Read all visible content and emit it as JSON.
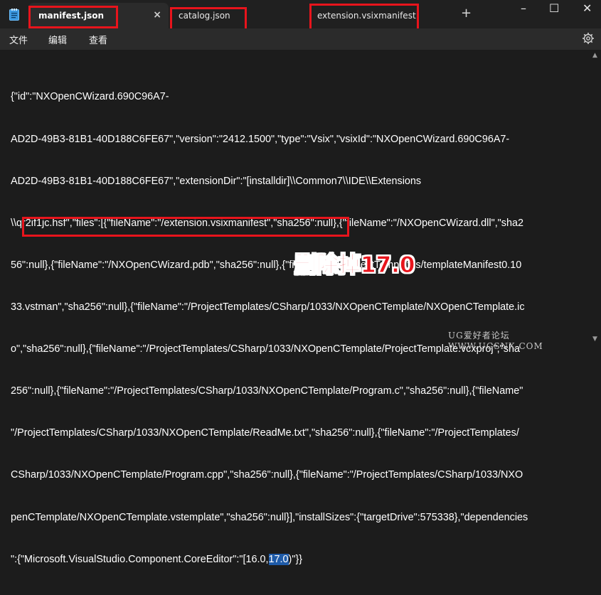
{
  "tabs": [
    {
      "label": "manifest.json",
      "active": true,
      "close_icon": "×"
    },
    {
      "label": "catalog.json",
      "active": false
    },
    {
      "label": "extension.vsixmanifest",
      "active": false
    }
  ],
  "tab_add": "+",
  "window_controls": {
    "minimize": "–",
    "maximize": "☐",
    "close": "✕"
  },
  "menu": {
    "file": "文件",
    "edit": "编辑",
    "view": "查看"
  },
  "editor": {
    "lines": [
      "{\"id\":\"NXOpenCWizard.690C96A7-",
      "AD2D-49B3-81B1-40D188C6FE67\",\"version\":\"2412.1500\",\"type\":\"Vsix\",\"vsixId\":\"NXOpenCWizard.690C96A7-",
      "AD2D-49B3-81B1-40D188C6FE67\",\"extensionDir\":\"[installdir]\\\\Common7\\\\IDE\\\\Extensions",
      "\\\\qr2if1jc.hsf\",\"files\":[{\"fileName\":\"/extension.vsixmanifest\",\"sha256\":null},{\"fileName\":\"/NXOpenCWizard.dll\",\"sha2",
      "56\":null},{\"fileName\":\"/NXOpenCWizard.pdb\",\"sha256\":null},{\"fileName\":\"/ProjectTemplates/templateManifest0.10",
      "33.vstman\",\"sha256\":null},{\"fileName\":\"/ProjectTemplates/CSharp/1033/NXOpenCTemplate/NXOpenCTemplate.ic",
      "o\",\"sha256\":null},{\"fileName\":\"/ProjectTemplates/CSharp/1033/NXOpenCTemplate/ProjectTemplate.vcxproj\",\"sha",
      "256\":null},{\"fileName\":\"/ProjectTemplates/CSharp/1033/NXOpenCTemplate/Program.c\",\"sha256\":null},{\"fileName\"",
      "\"/ProjectTemplates/CSharp/1033/NXOpenCTemplate/ReadMe.txt\",\"sha256\":null},{\"fileName\":\"/ProjectTemplates/",
      "CSharp/1033/NXOpenCTemplate/Program.cpp\",\"sha256\":null},{\"fileName\":\"/ProjectTemplates/CSharp/1033/NXO",
      "penCTemplate/NXOpenCTemplate.vstemplate\",\"sha256\":null}],\"installSizes\":{\"targetDrive\":575338},\"dependencies"
    ],
    "last_line_before": "\":{\"Microsoft.VisualStudio.Component.CoreEditor\":\"[16.0,",
    "last_line_selected": "17.0",
    "last_line_after": ")\"}}"
  },
  "annotation": "删除掉17.0",
  "watermark": "UG爱好者论坛 WWW.UGSNX.COM",
  "colors": {
    "annotation_red": "#e8141c",
    "selection": "#1f5ba8",
    "background": "#1c1c1c"
  }
}
